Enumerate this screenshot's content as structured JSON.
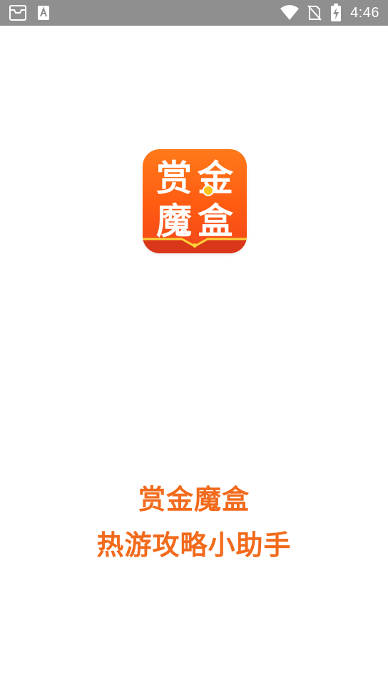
{
  "status_bar": {
    "time": "4:46",
    "icons": [
      "notification-inbox-icon",
      "keyboard-a-icon",
      "wifi-icon",
      "no-sim-icon",
      "battery-charging-icon"
    ]
  },
  "logo": {
    "chars": [
      "赏",
      "金",
      "魔",
      "盒"
    ],
    "colors": {
      "top": "#ff7a1a",
      "bottom": "#f3461a",
      "coin": "#ffc21a"
    }
  },
  "splash": {
    "app_name": "赏金魔盒",
    "tagline": "热游攻略小助手",
    "accent_color": "#f26a1b"
  }
}
